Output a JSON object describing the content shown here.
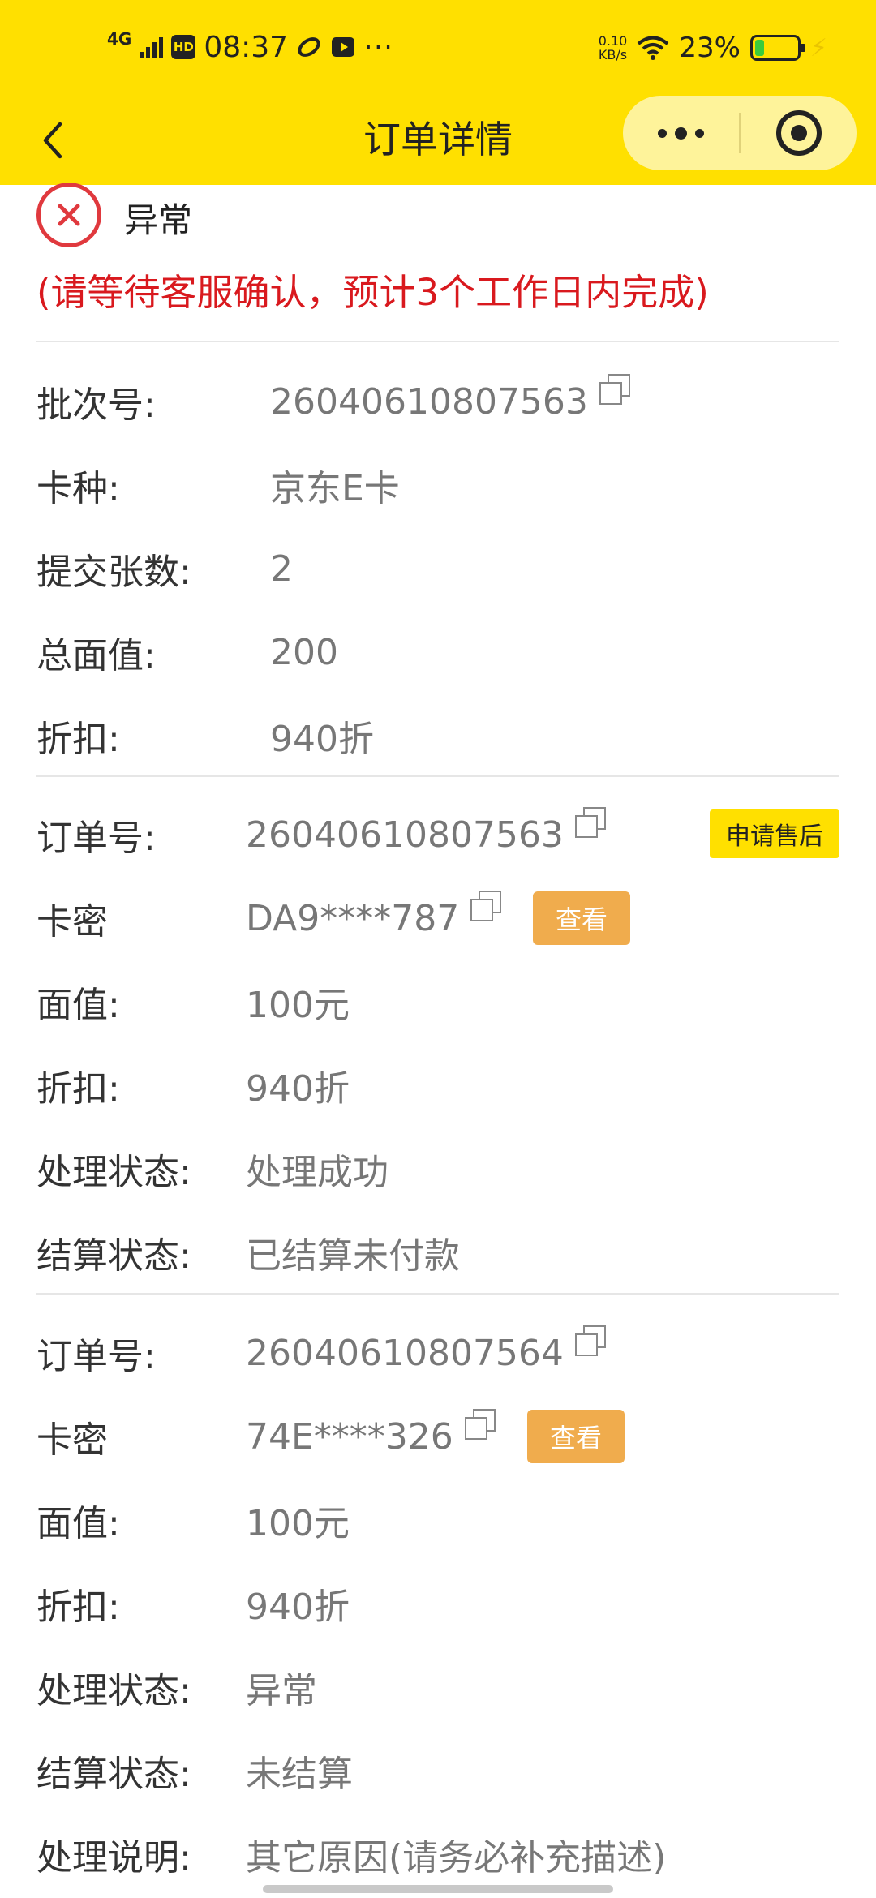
{
  "status_bar": {
    "network": "4G",
    "hd_badge": "HD",
    "time": "08:37",
    "more_dots": "···",
    "speed_value": "0.10",
    "speed_unit": "KB/s",
    "battery_pct": "23%",
    "battery_level": 0.23
  },
  "nav": {
    "title": "订单详情"
  },
  "status": {
    "label": "异常",
    "note": "(请等待客服确认，预计3个工作日内完成)"
  },
  "batch": {
    "batch_no_label": "批次号:",
    "batch_no": "26040610807563",
    "card_type_label": "卡种:",
    "card_type": "京东E卡",
    "count_label": "提交张数:",
    "count": "2",
    "total_label": "总面值:",
    "total": "200",
    "discount_label": "折扣:",
    "discount": "940折"
  },
  "orders": [
    {
      "order_no_label": "订单号:",
      "order_no": "26040610807563",
      "after_sale_btn": "申请售后",
      "card_secret_label": "卡密",
      "card_secret": "DA9****787",
      "view_btn": "查看",
      "face_value_label": "面值:",
      "face_value": "100元",
      "discount_label": "折扣:",
      "discount": "940折",
      "process_status_label": "处理状态:",
      "process_status": "处理成功",
      "settle_status_label": "结算状态:",
      "settle_status": "已结算未付款"
    },
    {
      "order_no_label": "订单号:",
      "order_no": "26040610807564",
      "card_secret_label": "卡密",
      "card_secret": "74E****326",
      "view_btn": "查看",
      "face_value_label": "面值:",
      "face_value": "100元",
      "discount_label": "折扣:",
      "discount": "940折",
      "process_status_label": "处理状态:",
      "process_status": "异常",
      "settle_status_label": "结算状态:",
      "settle_status": "未结算",
      "remark_label": "处理说明:",
      "remark": "其它原因(请务必补充描述)"
    }
  ]
}
